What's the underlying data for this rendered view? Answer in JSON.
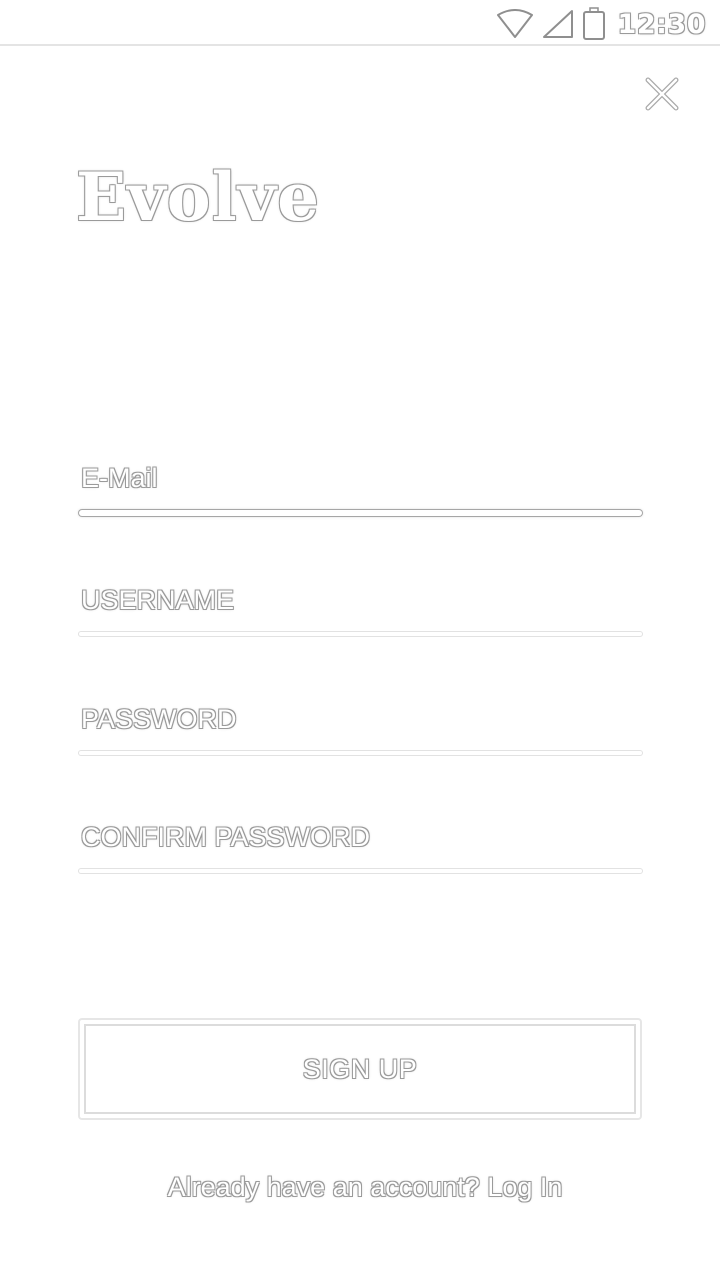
{
  "status_bar": {
    "time": "12:30",
    "icons": [
      "wifi-icon",
      "cell-signal-icon",
      "battery-icon"
    ]
  },
  "close": {
    "icon": "close-icon"
  },
  "app": {
    "logo": "Evolve"
  },
  "form": {
    "email": {
      "placeholder": "E-Mail",
      "value": ""
    },
    "username": {
      "placeholder": "USERNAME",
      "value": ""
    },
    "password": {
      "placeholder": "PASSWORD",
      "value": ""
    },
    "confirm_password": {
      "placeholder": "CONFIRM PASSWORD",
      "value": ""
    }
  },
  "actions": {
    "signup_label": "SIGN UP",
    "login_prompt": "Already have an account? Log In"
  },
  "colors": {
    "background": "#ffffff",
    "outline": "#9a9a9a",
    "divider": "#e4e4e4"
  }
}
